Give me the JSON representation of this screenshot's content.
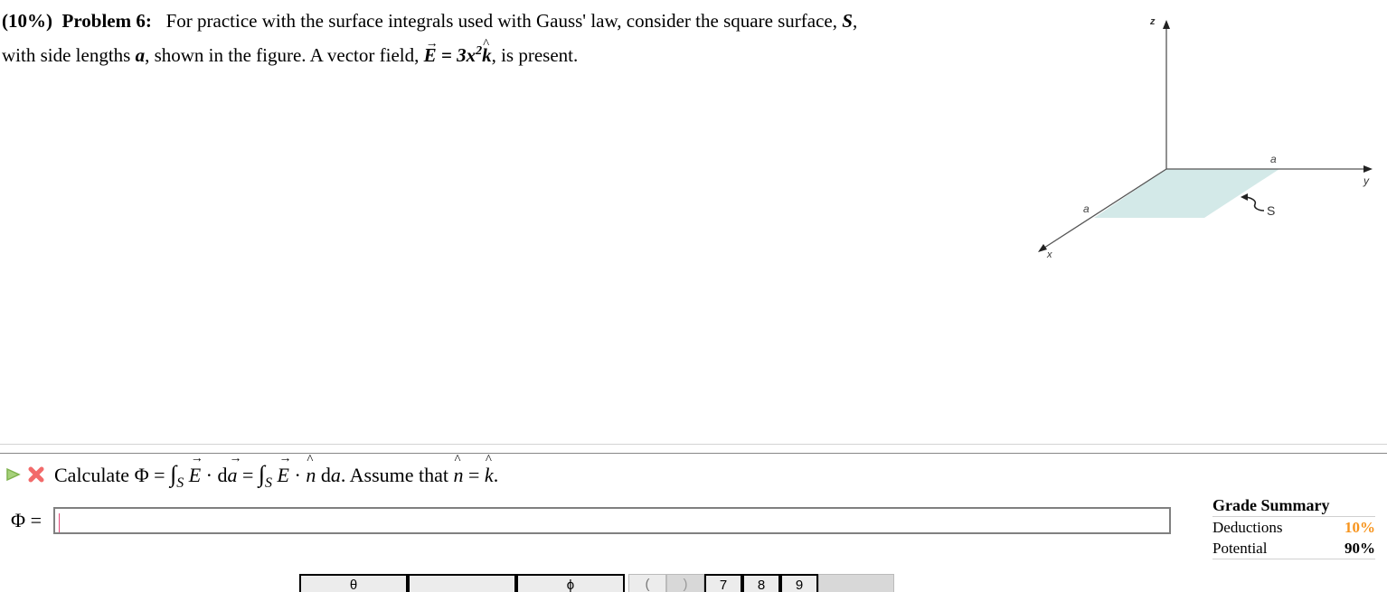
{
  "problem": {
    "weight": "(10%)",
    "number": "Problem 6:",
    "text_part1": "For practice with the surface integrals used with Gauss' law, consider the square surface,",
    "surface_symbol": "S",
    "text_part2": "with side lengths",
    "side_symbol": "a",
    "text_part3": ", shown in the figure. A vector field,",
    "field_symbol": "E",
    "field_equals": " = 3x",
    "field_exponent": "2",
    "field_unit": "k",
    "text_part4": ", is present."
  },
  "figure": {
    "axis_labels": {
      "z": "z",
      "y": "y",
      "x": "x"
    },
    "side_labels": [
      "a",
      "a"
    ],
    "surface_label": "S",
    "surface_color": "#d3e9e8"
  },
  "question": {
    "play_icon": "play-icon",
    "status_icon": "incorrect-x-icon",
    "prefix": "Calculate",
    "phi": "Φ",
    "eq1": " = ",
    "integral": "∫",
    "sub_s": "S",
    "E": "E",
    "dot": " · ",
    "da": "d",
    "a_vec": "a",
    "eq2": " = ",
    "n_hat": "n",
    "da2": " d",
    "a2": "a",
    "suffix": ". Assume that ",
    "eq3": " = ",
    "k_hat": "k",
    "end": "."
  },
  "answer": {
    "label": "Φ =",
    "value": ""
  },
  "grade_summary": {
    "title": "Grade Summary",
    "rows": [
      {
        "label": "Deductions",
        "value": "10%",
        "color": "#f7941d"
      },
      {
        "label": "Potential",
        "value": "90%"
      }
    ]
  },
  "keypad": {
    "keys": [
      "θ",
      "",
      "ϕ",
      "(",
      ")",
      "7",
      "8",
      "9",
      ""
    ]
  }
}
